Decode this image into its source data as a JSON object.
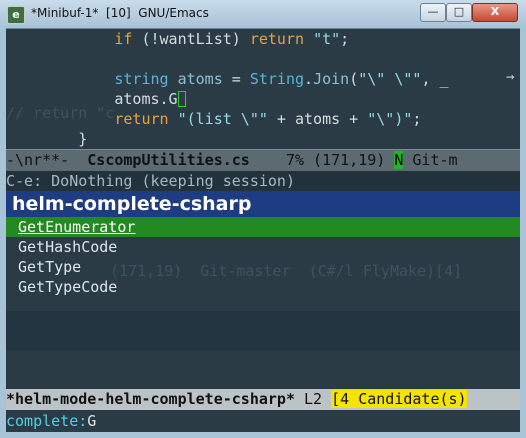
{
  "window": {
    "title": "*Minibuf-1*  [10]  GNU/Emacs",
    "buttons": {
      "minimize": "—",
      "maximize": "□",
      "close": "X"
    }
  },
  "editor": {
    "lines": [
      {
        "indent": "            ",
        "tokens": [
          {
            "t": "kw",
            "v": "if"
          },
          {
            "t": "plain",
            "v": " (!wantList) "
          },
          {
            "t": "kw",
            "v": "return"
          },
          {
            "t": "plain",
            "v": " "
          },
          {
            "t": "str",
            "v": "\"t\""
          },
          {
            "t": "plain",
            "v": ";"
          }
        ]
      },
      {
        "indent": "",
        "tokens": []
      },
      {
        "indent": "            ",
        "tokens": [
          {
            "t": "ty",
            "v": "string"
          },
          {
            "t": "plain",
            "v": " "
          },
          {
            "t": "fn",
            "v": "atoms"
          },
          {
            "t": "plain",
            "v": " = "
          },
          {
            "t": "ty",
            "v": "String"
          },
          {
            "t": "plain",
            "v": "."
          },
          {
            "t": "fn",
            "v": "Join"
          },
          {
            "t": "plain",
            "v": "("
          },
          {
            "t": "str",
            "v": "\"\\\" \\\"\""
          },
          {
            "t": "plain",
            "v": ", _"
          }
        ]
      },
      {
        "indent": "            ",
        "tokens": [
          {
            "t": "plain",
            "v": "atoms.G"
          }
        ],
        "cursor": true
      },
      {
        "indent": "            ",
        "tokens": [
          {
            "t": "kw",
            "v": "return"
          },
          {
            "t": "plain",
            "v": " "
          },
          {
            "t": "str",
            "v": "\"(list \\\"\""
          },
          {
            "t": "plain",
            "v": " + atoms + "
          },
          {
            "t": "str",
            "v": "\"\\\")\""
          },
          {
            "t": "plain",
            "v": ";"
          }
        ]
      },
      {
        "indent": "        ",
        "tokens": [
          {
            "t": "plain",
            "v": "}"
          }
        ]
      }
    ],
    "ghost_text_1": "// return \"c",
    "ghost_text_2": "(171,19)  Git-master  (C#/l FlyMake)[4]"
  },
  "modeline": {
    "prefix": "-\\nr**-  ",
    "buffer": "CscompUtilities.cs",
    "position": "    7% (171,19) ",
    "n_flag": "N",
    "vc": " Git-m"
  },
  "session_line": "C-e: DoNothing (keeping session)",
  "helm": {
    "source_header": "helm-complete-csharp",
    "candidates": [
      "GetEnumerator",
      "GetHashCode",
      "GetType",
      "GetTypeCode"
    ],
    "modeline": {
      "name": "*helm-mode-helm-complete-csharp*",
      "line": " L2 ",
      "count": "[4 Candidate(s)"
    }
  },
  "minibuffer": {
    "prompt": "complete:",
    "value": "G"
  }
}
